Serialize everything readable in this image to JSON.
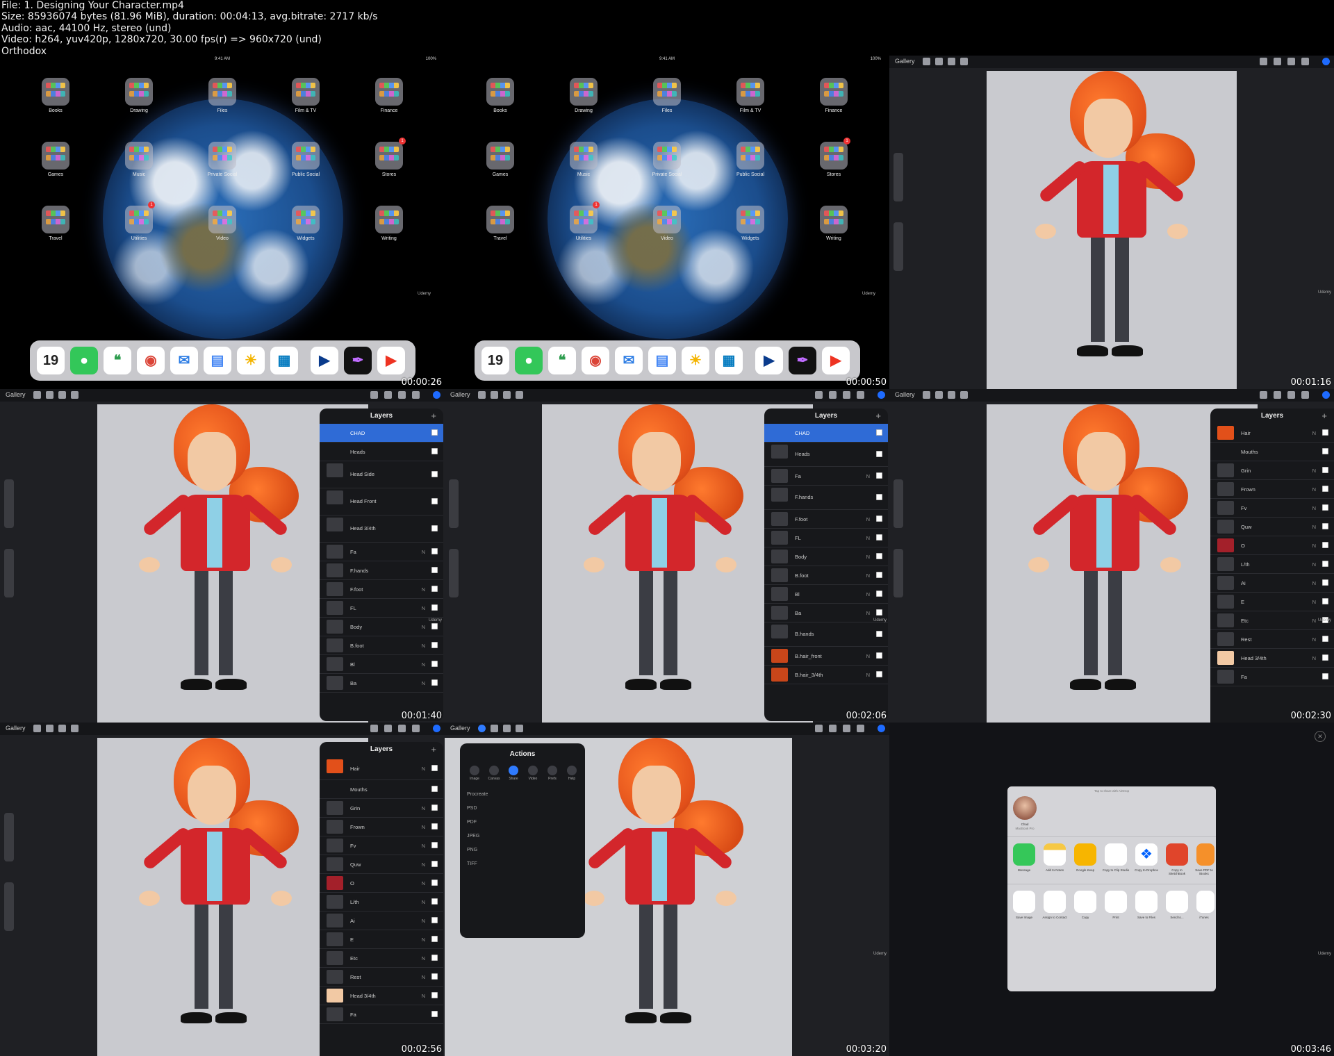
{
  "header": {
    "line1": "File: 1. Designing Your Character.mp4",
    "line2": "Size: 85936074 bytes (81.96 MiB), duration: 00:04:13, avg.bitrate: 2717 kb/s",
    "line3": "Audio: aac, 44100 Hz, stereo (und)",
    "line4": "Video: h264, yuv420p, 1280x720, 30.00 fps(r) => 960x720 (und)",
    "line5": "Orthodox"
  },
  "home": {
    "time": "9:41 AM",
    "battery": "100%",
    "folders": [
      "Books",
      "Drawing",
      "Files",
      "Film & TV",
      "Finance",
      "Games",
      "Music",
      "Private Social",
      "Public Social",
      "Stores",
      "Travel",
      "Utilities",
      "Video",
      "Widgets",
      "Writing"
    ],
    "badges": {
      "stores": "1",
      "utilities": "1"
    },
    "dock_date_day": "Wed",
    "dock_date_num": "19"
  },
  "procreate": {
    "gallery": "Gallery",
    "layers_title": "Layers",
    "plus": "+",
    "blend_n": "N",
    "watermark": "Udemy"
  },
  "layers_a": [
    "CHAD",
    "Heads",
    "Head Side",
    "Head Front",
    "Head 3/4th",
    "Fa",
    "F.hands",
    "F.foot",
    "FL",
    "Body",
    "B.foot",
    "Bl",
    "Ba"
  ],
  "layers_b": [
    "CHAD",
    "Heads",
    "Fa",
    "F.hands",
    "F.foot",
    "FL",
    "Body",
    "B.foot",
    "Bl",
    "Ba",
    "B.hands",
    "B.hair_front",
    "B.hair_3/4th"
  ],
  "layers_c": [
    "Hair",
    "Mouths",
    "Grin",
    "Frown",
    "Fv",
    "Quw",
    "O",
    "L/th",
    "Ai",
    "E",
    "Etc",
    "Rest",
    "Head 3/4th",
    "Fa"
  ],
  "actions": {
    "title": "Actions",
    "tabs": [
      "Image",
      "Canvas",
      "Share",
      "Video",
      "Prefs",
      "Help"
    ],
    "items": [
      "Procreate",
      "PSD",
      "PDF",
      "JPEG",
      "PNG",
      "TIFF"
    ]
  },
  "share": {
    "hint": "Tap to share with AirDrop",
    "contact": "Chad",
    "contact_sub": "MacBook Pro",
    "apps": [
      "Message",
      "Add to Notes",
      "Google Keep",
      "Copy to Clip Studio",
      "Copy to Dropbox",
      "Copy to SketchBook",
      "Save PDF to iBooks"
    ],
    "actions": [
      "Save Image",
      "Assign to Contact",
      "Copy",
      "Print",
      "Save to Files",
      "Send to...",
      "iTunes"
    ]
  },
  "timestamps": [
    "00:00:26",
    "00:00:50",
    "00:01:16",
    "00:01:40",
    "00:02:06",
    "00:02:30",
    "00:02:56",
    "00:03:20",
    "00:03:46"
  ]
}
